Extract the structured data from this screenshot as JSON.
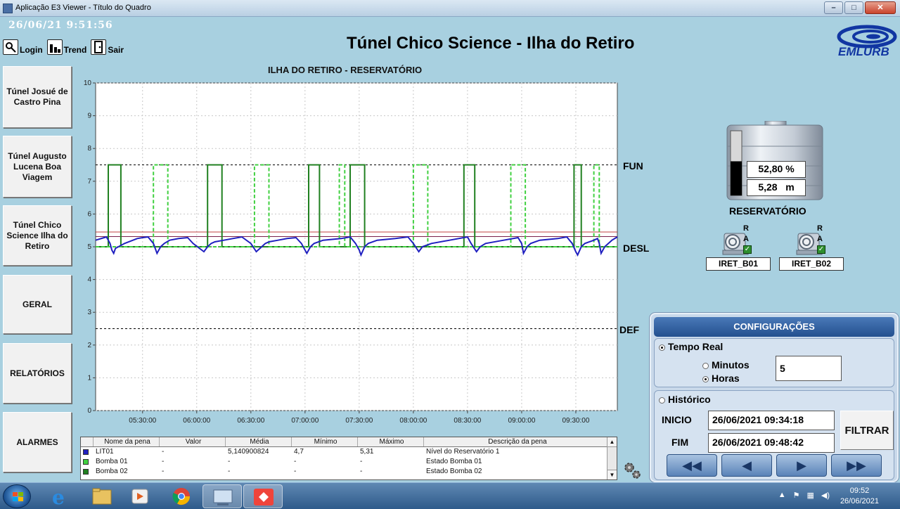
{
  "window": {
    "title": "Aplicação E3 Viewer - Título do Quadro",
    "buttons": [
      "–",
      "□",
      "✕"
    ]
  },
  "header": {
    "datetime": "26/06/21 9:51:56",
    "title": "Túnel Chico Science - Ilha do Retiro",
    "logo_text": "EMLURB",
    "toolbar": [
      {
        "label": "Login",
        "icon": "key-icon"
      },
      {
        "label": "Trend",
        "icon": "trend-icon"
      },
      {
        "label": "Sair",
        "icon": "exit-door-icon"
      }
    ]
  },
  "nav": [
    {
      "label": "Túnel Josué de Castro Pina"
    },
    {
      "label": "Túnel Augusto Lucena Boa Viagem"
    },
    {
      "label": "Túnel Chico Science Ilha do Retiro"
    },
    {
      "label": "GERAL"
    },
    {
      "label": "RELATÓRIOS"
    },
    {
      "label": "ALARMES"
    }
  ],
  "chart_data": {
    "type": "line",
    "title": "ILHA DO RETIRO - RESERVATÓRIO",
    "xlabel": "",
    "ylabel": "",
    "ylim": [
      0,
      10
    ],
    "xlim": [
      "05:04",
      "09:53"
    ],
    "y_ticks": [
      "0",
      "1",
      "2",
      "3",
      "4",
      "5",
      "6",
      "7",
      "8",
      "9",
      "10"
    ],
    "x_ticks": [
      "05:30:00",
      "06:00:00",
      "06:30:00",
      "07:00:00",
      "07:30:00",
      "08:00:00",
      "08:30:00",
      "09:00:00",
      "09:30:00"
    ],
    "grid": true,
    "reference_lines": [
      {
        "label": "FUN",
        "value": 7.5,
        "color": "#000000",
        "style": "dashed"
      },
      {
        "label": "DESL",
        "value": 5.0,
        "color": "#000000",
        "style": "dashed"
      },
      {
        "label": "DEF",
        "value": 2.5,
        "color": "#000000",
        "style": "dashed"
      },
      {
        "label": "",
        "value": 5.45,
        "color": "#c04040",
        "style": "solid"
      },
      {
        "label": "",
        "value": 5.31,
        "color": "#7a1f4a",
        "style": "solid"
      }
    ],
    "series": [
      {
        "name": "LIT01",
        "color": "#2020c0",
        "style": "solid",
        "x": [
          "05:04",
          "05:10",
          "05:12",
          "05:13",
          "05:14",
          "05:15",
          "05:20",
          "05:27",
          "05:30",
          "05:33",
          "05:36",
          "05:38",
          "05:40",
          "05:42",
          "05:45",
          "05:50",
          "05:55",
          "05:58",
          "06:04",
          "06:06",
          "06:08",
          "06:10",
          "06:15",
          "06:20",
          "06:25",
          "06:30",
          "06:33",
          "06:36",
          "06:38",
          "06:40",
          "06:45",
          "06:50",
          "06:55",
          "06:58",
          "07:00",
          "07:01",
          "07:03",
          "07:05",
          "07:10",
          "07:20",
          "07:25",
          "07:28",
          "07:30",
          "07:31",
          "07:33",
          "07:35",
          "07:40",
          "07:50",
          "07:57",
          "08:00",
          "08:03",
          "08:05",
          "08:10",
          "08:20",
          "08:30",
          "08:32",
          "08:35",
          "08:37",
          "08:40",
          "08:50",
          "08:58",
          "09:00",
          "09:01",
          "09:03",
          "09:05",
          "09:10",
          "09:20",
          "09:25",
          "09:28",
          "09:30",
          "09:31",
          "09:33",
          "09:35",
          "09:40",
          "09:42",
          "09:43",
          "09:44",
          "09:46",
          "09:50",
          "09:53"
        ],
        "values": [
          5.2,
          5.3,
          5.1,
          4.9,
          4.8,
          4.95,
          5.1,
          5.25,
          5.28,
          5.3,
          5.1,
          4.8,
          5.0,
          5.1,
          5.2,
          5.25,
          5.28,
          5.1,
          4.85,
          5.0,
          5.1,
          5.15,
          5.2,
          5.25,
          5.3,
          5.1,
          4.85,
          5.0,
          5.1,
          5.15,
          5.2,
          5.25,
          5.28,
          5.1,
          4.9,
          4.8,
          5.0,
          5.1,
          5.2,
          5.25,
          5.3,
          5.1,
          4.9,
          4.75,
          5.0,
          5.1,
          5.2,
          5.25,
          5.3,
          5.1,
          4.85,
          5.0,
          5.1,
          5.2,
          5.3,
          5.1,
          4.85,
          5.0,
          5.1,
          5.2,
          5.28,
          5.1,
          4.8,
          5.0,
          5.1,
          5.2,
          5.25,
          5.3,
          5.1,
          4.85,
          4.75,
          5.0,
          5.1,
          5.2,
          5.25,
          5.1,
          4.8,
          5.0,
          5.2,
          5.3
        ]
      },
      {
        "name": "Bomba 01",
        "color": "#40d040",
        "style": "dashed",
        "x": [
          "05:04",
          "05:36",
          "05:36",
          "05:44",
          "05:44",
          "06:32",
          "06:32",
          "06:40",
          "06:40",
          "07:19",
          "07:19",
          "07:22",
          "07:22",
          "08:00",
          "08:00",
          "08:08",
          "08:08",
          "08:54",
          "08:54",
          "09:02",
          "09:02",
          "09:40",
          "09:40",
          "09:43",
          "09:43",
          "09:53"
        ],
        "values": [
          5,
          5,
          7.5,
          7.5,
          5,
          5,
          7.5,
          7.5,
          5,
          5,
          7.5,
          7.5,
          5,
          5,
          7.5,
          7.5,
          5,
          5,
          7.5,
          7.5,
          5,
          5,
          7.5,
          7.5,
          5,
          5
        ]
      },
      {
        "name": "Bomba 02",
        "color": "#208020",
        "style": "solid",
        "x": [
          "05:04",
          "05:11",
          "05:11",
          "05:18",
          "05:18",
          "06:06",
          "06:06",
          "06:14",
          "06:14",
          "07:02",
          "07:02",
          "07:08",
          "07:08",
          "07:25",
          "07:25",
          "07:33",
          "07:33",
          "08:28",
          "08:28",
          "08:34",
          "08:34",
          "09:29",
          "09:29",
          "09:33",
          "09:33",
          "09:53"
        ],
        "values": [
          5,
          5,
          7.5,
          7.5,
          5,
          5,
          7.5,
          7.5,
          5,
          5,
          7.5,
          7.5,
          5,
          5,
          7.5,
          7.5,
          5,
          5,
          7.5,
          7.5,
          5,
          5,
          7.5,
          7.5,
          5,
          5
        ]
      }
    ]
  },
  "pen_table": {
    "headers": [
      "",
      "Nome da pena",
      "Valor",
      "Média",
      "Mínimo",
      "Máximo",
      "Descrição da pena"
    ],
    "rows": [
      {
        "color": "#2020c0",
        "name": "LIT01",
        "valor": "-",
        "media": "5,140900824",
        "minimo": "4,7",
        "maximo": "5,31",
        "descricao": "Nível do Reservatório 1"
      },
      {
        "color": "#40d040",
        "name": "Bomba 01",
        "valor": "-",
        "media": "-",
        "minimo": "-",
        "maximo": "-",
        "descricao": "Estado Bomba 01"
      },
      {
        "color": "#208020",
        "name": "Bomba 02",
        "valor": "-",
        "media": "-",
        "minimo": "-",
        "maximo": "-",
        "descricao": "Estado Bomba 02"
      }
    ]
  },
  "reservoir": {
    "percent": "52,80 %",
    "level": "5,28",
    "unit": "m",
    "label": "RESERVATÓRIO",
    "fill_fraction": 0.528
  },
  "pumps": [
    {
      "tag": "IRET_B01",
      "r": "R",
      "a": "A",
      "checked": true
    },
    {
      "tag": "IRET_B02",
      "r": "R",
      "a": "A",
      "checked": true
    }
  ],
  "config": {
    "title": "CONFIGURAÇÕES",
    "tempo_real": "Tempo Real",
    "minutos": "Minutos",
    "horas": "Horas",
    "value": "5",
    "historico": "Histórico",
    "inicio_label": "INICIO",
    "inicio_value": "26/06/2021 09:34:18",
    "fim_label": "FIM",
    "fim_value": "26/06/2021 09:48:42",
    "filter_label": "FILTRAR",
    "nav_arrows": [
      "◀◀",
      "◀",
      "▶",
      "▶▶"
    ]
  },
  "taskbar": {
    "time": "09:52",
    "date": "26/06/2021",
    "apps": [
      "windows-start-icon",
      "internet-explorer-icon",
      "file-explorer-icon",
      "media-player-icon",
      "chrome-icon",
      "e3-viewer-icon",
      "anydesk-icon"
    ]
  }
}
